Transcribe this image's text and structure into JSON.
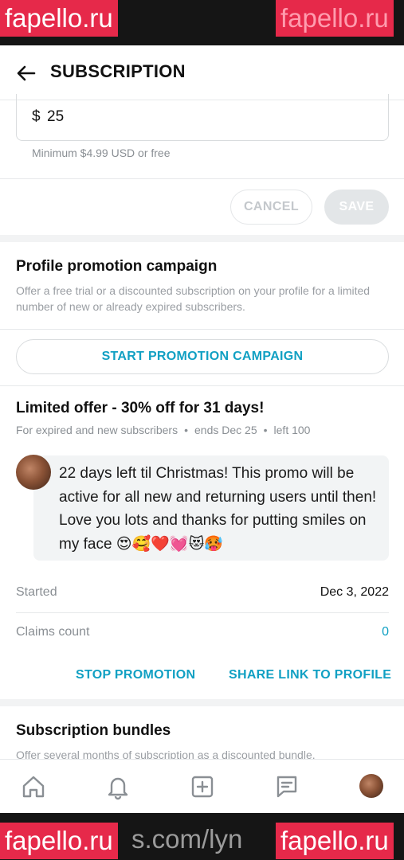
{
  "watermark": {
    "badge_left": "fapello.ru",
    "badge_right": "fapello.ru",
    "bottom_url": "s.com/lyn",
    "bottom_badge_left": "fapello.ru",
    "bottom_badge_right": "fapello.ru"
  },
  "header": {
    "title": "SUBSCRIPTION"
  },
  "price": {
    "currency": "$",
    "value": "25",
    "hint": "Minimum $4.99 USD or free"
  },
  "actions": {
    "cancel_label": "CANCEL",
    "save_label": "SAVE"
  },
  "promotion": {
    "title": "Profile promotion campaign",
    "description": "Offer a free trial or a discounted subscription on your profile for a limited number of new or already expired subscribers.",
    "start_label": "START PROMOTION CAMPAIGN"
  },
  "offer": {
    "title": "Limited offer - 30% off for 31 days!",
    "meta_audience": "For expired and new subscribers",
    "meta_ends": "ends Dec 25",
    "meta_left": "left 100",
    "message": "22 days left til Christmas! This promo will be active for all new and returning users until then! Love you lots and thanks for putting smiles on my face 😍🥰❤️💓😻🥵",
    "started_label": "Started",
    "started_value": "Dec 3, 2022",
    "claims_label": "Claims count",
    "claims_value": "0",
    "stop_label": "STOP PROMOTION",
    "share_label": "SHARE LINK TO PROFILE"
  },
  "bundles": {
    "title": "Subscription bundles",
    "description": "Offer several months of subscription as a discounted bundle."
  },
  "nav": {
    "icons": [
      "home-icon",
      "bell-icon",
      "plus-square-icon",
      "chat-icon",
      "avatar"
    ]
  },
  "colors": {
    "accent": "#11a0c3",
    "watermark": "#e6294a"
  }
}
